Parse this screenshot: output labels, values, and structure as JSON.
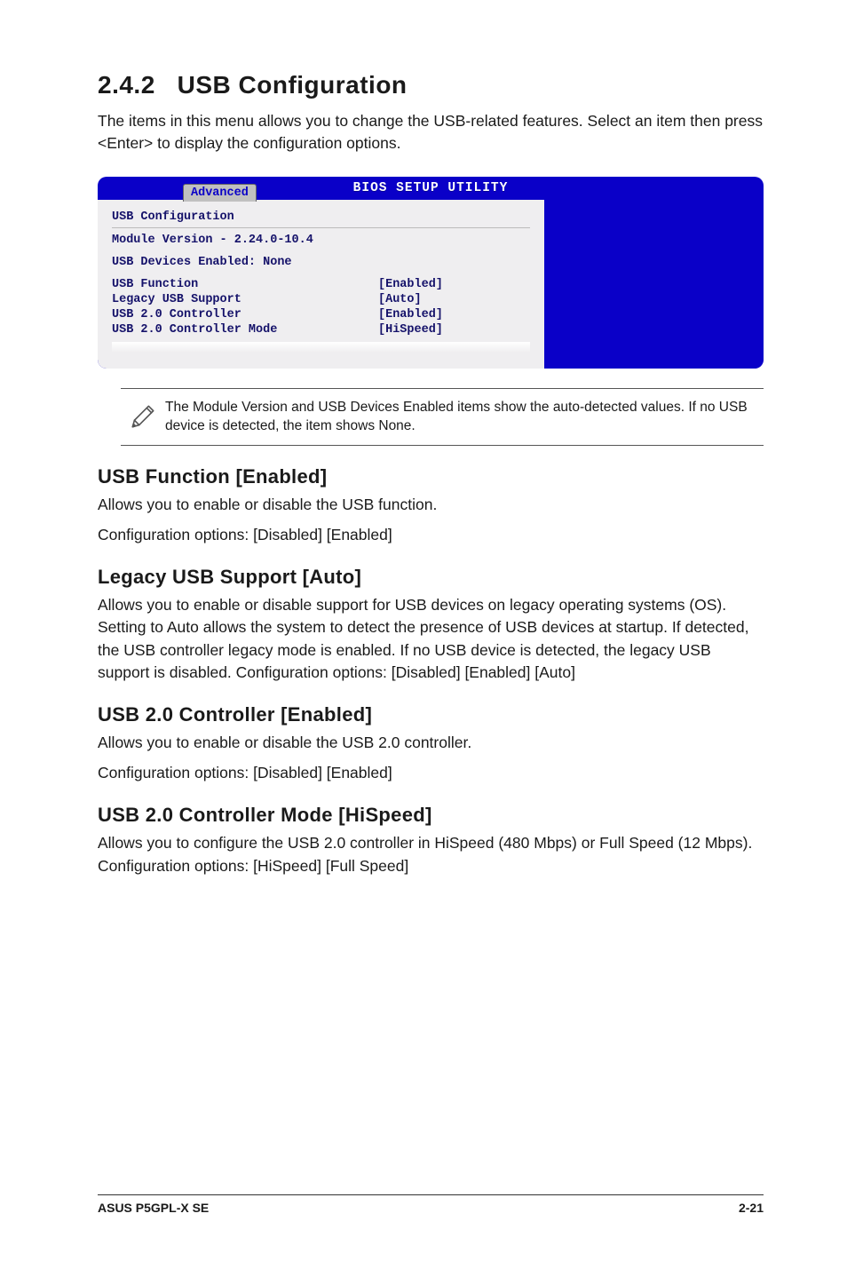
{
  "section": {
    "number": "2.4.2",
    "title": "USB Configuration",
    "intro": "The items in this menu allows you to change the USB-related features. Select an item then press <Enter> to display the configuration options."
  },
  "bios": {
    "utility_title": "BIOS SETUP UTILITY",
    "tab_label": "Advanced",
    "heading": "USB Configuration",
    "module_version_line": "Module Version - 2.24.0-10.4",
    "devices_line": "USB Devices Enabled: None",
    "rows": [
      {
        "label": "USB Function",
        "value": "[Enabled]"
      },
      {
        "label": "Legacy USB Support",
        "value": "[Auto]"
      },
      {
        "label": "USB 2.0 Controller",
        "value": "[Enabled]"
      },
      {
        "label": "USB 2.0 Controller Mode",
        "value": "[HiSpeed]"
      }
    ]
  },
  "note": {
    "text": "The Module Version and USB Devices Enabled items show the auto-detected values. If no USB device is detected, the item shows None."
  },
  "items": [
    {
      "title": "USB Function [Enabled]",
      "body1": "Allows you to enable or disable the USB function.",
      "body2": "Configuration options: [Disabled] [Enabled]"
    },
    {
      "title": "Legacy USB Support [Auto]",
      "body1": "Allows you to enable or disable support for USB devices on legacy operating systems (OS). Setting to Auto allows the system to detect the presence of USB devices at startup. If detected, the USB controller legacy mode is enabled. If no USB device is detected, the legacy USB support is disabled. Configuration options: [Disabled] [Enabled] [Auto]",
      "body2": ""
    },
    {
      "title": "USB 2.0 Controller [Enabled]",
      "body1": "Allows you to enable or disable the USB 2.0 controller.",
      "body2": "Configuration options: [Disabled] [Enabled]"
    },
    {
      "title": "USB 2.0 Controller Mode [HiSpeed]",
      "body1": "Allows you to configure the USB 2.0 controller in HiSpeed (480 Mbps) or Full Speed (12 Mbps). Configuration options: [HiSpeed] [Full Speed]",
      "body2": ""
    }
  ],
  "footer": {
    "left": "ASUS P5GPL-X SE",
    "right": "2-21"
  }
}
